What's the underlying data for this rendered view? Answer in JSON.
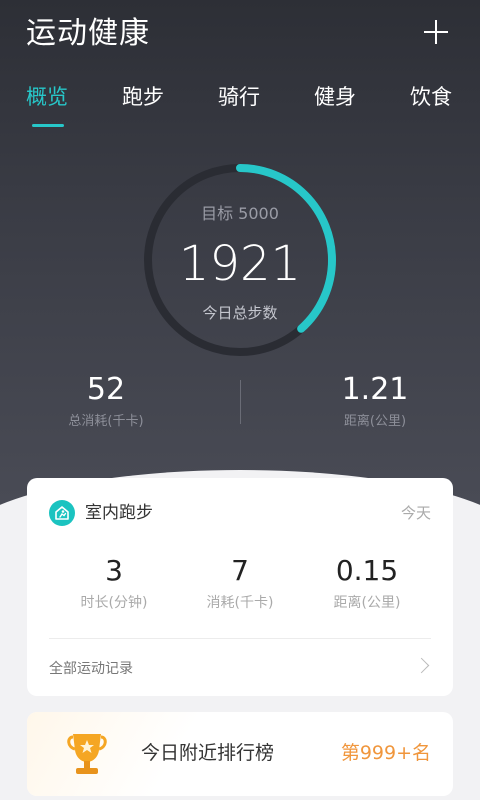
{
  "header": {
    "title": "运动健康",
    "add_icon": "plus-icon"
  },
  "tabs": [
    {
      "label": "概览",
      "active": true
    },
    {
      "label": "跑步",
      "active": false
    },
    {
      "label": "骑行",
      "active": false
    },
    {
      "label": "健身",
      "active": false
    },
    {
      "label": "饮食",
      "active": false
    }
  ],
  "summary": {
    "goal_label": "目标 5000",
    "steps": "1921",
    "steps_label": "今日总步数",
    "progress_fraction": 0.3842,
    "calories_value": "52",
    "calories_label": "总消耗(千卡)",
    "distance_value": "1.21",
    "distance_label": "距离(公里)"
  },
  "activity": {
    "icon": "indoor-run-icon",
    "title": "室内跑步",
    "day": "今天",
    "duration_value": "3",
    "duration_label": "时长(分钟)",
    "calories_value": "7",
    "calories_label": "消耗(千卡)",
    "distance_value": "0.15",
    "distance_label": "距离(公里)",
    "all_records_label": "全部运动记录"
  },
  "ranking": {
    "icon": "trophy-icon",
    "label": "今日附近排行榜",
    "value": "第999+名"
  },
  "colors": {
    "accent": "#27c7c9",
    "rank": "#f0963c"
  }
}
